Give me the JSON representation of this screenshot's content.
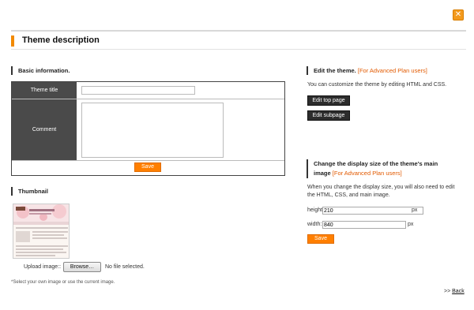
{
  "dialog": {
    "title": "Theme description",
    "close_symbol": "✕"
  },
  "basic": {
    "heading": "Basic information.",
    "theme_title_label": "Theme title",
    "theme_title_value": "",
    "comment_label": "Comment",
    "comment_value": "",
    "save_label": "Save"
  },
  "thumbnail": {
    "heading": "Thumbnail",
    "upload_label": "Upload image::",
    "browse_label": "Browse…",
    "file_status": "No file selected.",
    "note": "*Select your own image or use the current image."
  },
  "edit_theme": {
    "heading": "Edit the theme.",
    "plan_tag": "[For Advanced Plan users]",
    "description": "You can customize the theme by editing HTML and CSS.",
    "edit_top_label": "Edit top page",
    "edit_sub_label": "Edit subpage"
  },
  "display_size": {
    "heading_line1": "Change the display size of the theme's main",
    "heading_line2": "image",
    "plan_tag": "[For Advanced Plan users]",
    "desc_line1": "When you change the display size, you will also need to edit",
    "desc_line2": "the HTML, CSS, and main image.",
    "height_label": "height:",
    "height_value": "210",
    "width_label": "width:",
    "width_value": "840",
    "unit": "px",
    "save_label": "Save"
  },
  "footer": {
    "back_prefix": ">>",
    "back_label": "Back"
  },
  "colors": {
    "accent_orange": "#ff7f00",
    "dark_label_bg": "#4a4a4a",
    "plan_tag_text": "#e25a00"
  }
}
